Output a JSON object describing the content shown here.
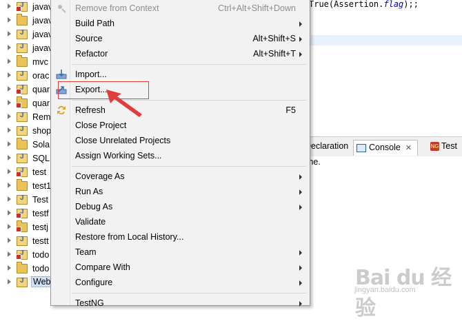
{
  "tree": {
    "items": [
      {
        "label": "javav",
        "error": true
      },
      {
        "label": "javav",
        "error": false
      },
      {
        "label": "javav",
        "error": false
      },
      {
        "label": "javav",
        "error": false
      },
      {
        "label": "mvc",
        "error": false
      },
      {
        "label": "orac",
        "error": false
      },
      {
        "label": "quar",
        "error": true
      },
      {
        "label": "quar",
        "error": true
      },
      {
        "label": "Rem",
        "error": false
      },
      {
        "label": "shop",
        "error": false
      },
      {
        "label": "Sola",
        "error": false
      },
      {
        "label": "SQL",
        "error": false
      },
      {
        "label": "test",
        "error": true
      },
      {
        "label": "test1",
        "error": false
      },
      {
        "label": "Test",
        "error": false
      },
      {
        "label": "testf",
        "error": true
      },
      {
        "label": "testj",
        "error": true
      },
      {
        "label": "testt",
        "error": false
      },
      {
        "label": "todo",
        "error": true
      },
      {
        "label": "todo",
        "error": false
      },
      {
        "label": "Web",
        "error": false,
        "selected": true
      }
    ]
  },
  "editor": {
    "code_prefix": "True(Assertion.",
    "code_field": "flag",
    "code_suffix": ");;"
  },
  "views": {
    "declaration_tab": "Declaration",
    "console_tab": "Console",
    "console_close": "✕",
    "testng_tab": "Test",
    "testng_icon_text": "NG",
    "console_message": "me."
  },
  "context_menu": {
    "items": [
      {
        "label": "Remove from Context",
        "shortcut": "Ctrl+Alt+Shift+Down",
        "disabled": true,
        "submenu": false,
        "icon": "remove-context-icon"
      },
      {
        "label": "Build Path",
        "shortcut": "",
        "submenu": true
      },
      {
        "label": "Source",
        "shortcut": "Alt+Shift+S",
        "submenu": true
      },
      {
        "label": "Refactor",
        "shortcut": "Alt+Shift+T",
        "submenu": true
      },
      {
        "separator": true
      },
      {
        "label": "Import...",
        "shortcut": "",
        "submenu": false,
        "icon": "import-icon"
      },
      {
        "label": "Export...",
        "shortcut": "",
        "submenu": false,
        "icon": "export-icon"
      },
      {
        "separator": true
      },
      {
        "label": "Refresh",
        "shortcut": "F5",
        "submenu": false,
        "icon": "refresh-icon"
      },
      {
        "label": "Close Project",
        "shortcut": "",
        "submenu": false
      },
      {
        "label": "Close Unrelated Projects",
        "shortcut": "",
        "submenu": false
      },
      {
        "label": "Assign Working Sets...",
        "shortcut": "",
        "submenu": false
      },
      {
        "separator": true
      },
      {
        "label": "Coverage As",
        "shortcut": "",
        "submenu": true
      },
      {
        "label": "Run As",
        "shortcut": "",
        "submenu": true
      },
      {
        "label": "Debug As",
        "shortcut": "",
        "submenu": true
      },
      {
        "label": "Validate",
        "shortcut": "",
        "submenu": false
      },
      {
        "label": "Restore from Local History...",
        "shortcut": "",
        "submenu": false
      },
      {
        "label": "Team",
        "shortcut": "",
        "submenu": true
      },
      {
        "label": "Compare With",
        "shortcut": "",
        "submenu": true
      },
      {
        "label": "Configure",
        "shortcut": "",
        "submenu": true
      },
      {
        "separator": true
      },
      {
        "label": "TestNG",
        "shortcut": "",
        "submenu": true
      }
    ]
  },
  "annotation": {
    "highlighted_item": "Export...",
    "color": "#e23d3d"
  },
  "watermark": {
    "text": "Bai du 经验",
    "sub": "jingyan.baidu.com"
  }
}
